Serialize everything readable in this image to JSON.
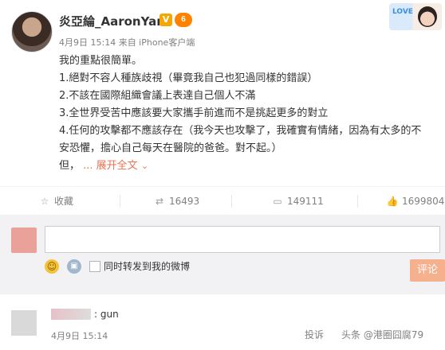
{
  "post": {
    "author": "炎亞綸_AaronYan",
    "verified_badge": "V",
    "member_badge": "𝟔",
    "meta": "4月9日 15:14 来自 iPhone客户端",
    "avatar_icon": "avatar",
    "card_tag": "LOVE",
    "lines": [
      "我的重點很簡單。",
      "1.絕對不容人種族歧視（畢竟我自己也犯過同樣的錯誤）",
      "2.不該在國際組織會議上表達自己個人不滿",
      "3.全世界受苦中應該要大家攜手前進而不是挑起更多的對立",
      "4.任何的攻擊都不應該存在（我今天也攻擊了，我確實有情緒，因為有太多的不",
      "安恐懼，擔心自己每天在醫院的爸爸。對不起。）"
    ],
    "last_line_prefix": "但，",
    "expand_label": "... 展开全文",
    "expand_icon": "chevron-down-icon"
  },
  "actions": {
    "favorite": "收藏",
    "repost": "16493",
    "comment": "149111",
    "like": "1699804"
  },
  "comment_box": {
    "input_value": "",
    "repost_checkbox_label": "同时转发到我的微博",
    "submit_label": "评论"
  },
  "first_comment": {
    "text": ": gun",
    "time": "4月9日 15:14",
    "report_label": "投诉",
    "watermark": "头条 @港圈囧腐79"
  },
  "colors": {
    "accent": "#eb7350",
    "submit_bg": "#f5b08d",
    "background_grey": "#f2f2f5"
  }
}
